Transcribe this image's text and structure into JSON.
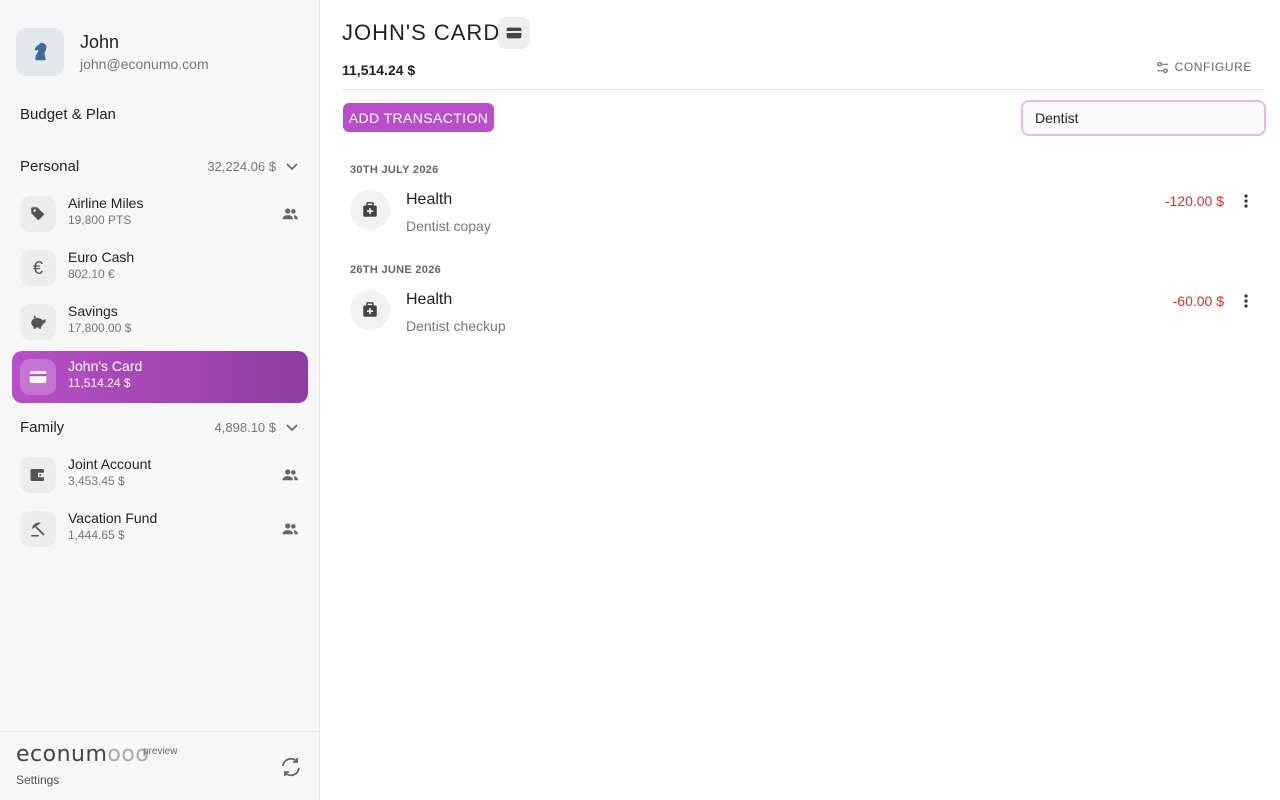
{
  "user": {
    "name": "John",
    "email": "john@econumo.com"
  },
  "sidebar": {
    "budget_link": "Budget & Plan",
    "folders": [
      {
        "name": "Personal",
        "total": "32,224.06 $",
        "accounts": [
          {
            "name": "Airline Miles",
            "balance": "19,800 PTS",
            "icon": "tag-icon",
            "shared": true
          },
          {
            "name": "Euro Cash",
            "balance": "802.10 €",
            "icon": "euro-icon",
            "icon_glyph": "€",
            "shared": false
          },
          {
            "name": "Savings",
            "balance": "17,800.00 $",
            "icon": "piggy-bank-icon",
            "shared": false
          },
          {
            "name": "John's Card",
            "balance": "11,514.24 $",
            "icon": "credit-card-icon",
            "shared": false,
            "active": true
          }
        ]
      },
      {
        "name": "Family",
        "total": "4,898.10 $",
        "accounts": [
          {
            "name": "Joint Account",
            "balance": "3,453.45 $",
            "icon": "wallet-icon",
            "shared": true
          },
          {
            "name": "Vacation Fund",
            "balance": "1,444.65 $",
            "icon": "beach-umbrella-icon",
            "shared": true
          }
        ]
      }
    ],
    "footer": {
      "logo": "econum",
      "logo_tail": "ooo",
      "preview": "preview",
      "settings": "Settings"
    }
  },
  "main": {
    "title": "JOHN'S CARD",
    "balance": "11,514.24 $",
    "configure_label": "CONFIGURE",
    "add_transaction_label": "ADD TRANSACTION",
    "search_value": "Dentist",
    "groups": [
      {
        "date": "30TH JULY 2026",
        "transactions": [
          {
            "category": "Health",
            "description": "Dentist copay",
            "amount": "-120.00 $",
            "icon": "medical-kit-icon"
          }
        ]
      },
      {
        "date": "26TH JUNE 2026",
        "transactions": [
          {
            "category": "Health",
            "description": "Dentist checkup",
            "amount": "-60.00 $",
            "icon": "medical-kit-icon"
          }
        ]
      }
    ]
  },
  "colors": {
    "accent": "#b84fc8",
    "accent_dark": "#8e3f9e",
    "negative": "#c0392b",
    "search_border": "#e7b8ef"
  }
}
